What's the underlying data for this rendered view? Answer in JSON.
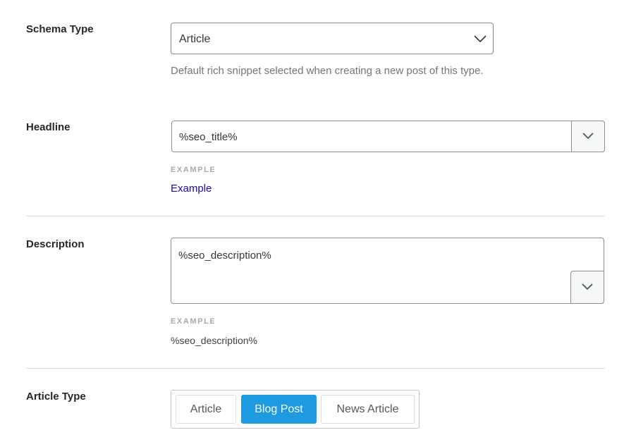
{
  "schema_type": {
    "label": "Schema Type",
    "selected": "Article",
    "help": "Default rich snippet selected when creating a new post of this type."
  },
  "headline": {
    "label": "Headline",
    "value": "%seo_title%",
    "example_label": "EXAMPLE",
    "example_value": "Example"
  },
  "description": {
    "label": "Description",
    "value": "%seo_description%",
    "example_label": "EXAMPLE",
    "example_value": "%seo_description%"
  },
  "article_type": {
    "label": "Article Type",
    "options": [
      "Article",
      "Blog Post",
      "News Article"
    ],
    "selected": "Blog Post"
  },
  "colors": {
    "accent": "#1e9ae0",
    "link": "#1a0dab",
    "help_text": "#72777c"
  }
}
